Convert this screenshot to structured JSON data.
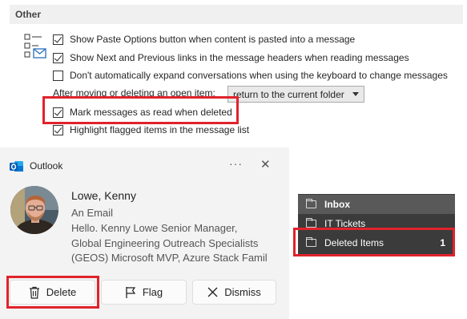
{
  "options": {
    "section_title": "Other",
    "icon": "mail-options-icon",
    "items": [
      {
        "label": "Show Paste Options button when content is pasted into a message",
        "checked": true
      },
      {
        "label": "Show Next and Previous links in the message headers when reading messages",
        "checked": true
      },
      {
        "label": "Don't automatically expand conversations when using the keyboard to change messages",
        "checked": false
      }
    ],
    "after_label": "After moving or deleting an open item:",
    "after_select_value": "return to the current folder",
    "items_after": [
      {
        "label": "Mark messages as read when deleted",
        "checked": true
      },
      {
        "label": "Highlight flagged items in the message list",
        "checked": true
      }
    ]
  },
  "toast": {
    "app_name": "Outlook",
    "more_glyph": "···",
    "close_glyph": "✕",
    "sender": "Lowe, Kenny",
    "subject": "An Email",
    "body_lines": [
      "Hello.  Kenny Lowe  Senior Manager,",
      "Global Engineering Outreach Specialists",
      "(GEOS)  Microsoft MVP, Azure Stack Famil"
    ],
    "buttons": {
      "delete": "Delete",
      "flag": "Flag",
      "dismiss": "Dismiss"
    }
  },
  "folders": [
    {
      "name": "Inbox",
      "count": "",
      "bold": true
    },
    {
      "name": "IT Tickets",
      "count": "",
      "bold": false
    },
    {
      "name": "Deleted Items",
      "count": "1",
      "bold": false
    }
  ],
  "colors": {
    "highlight_red": "#e0232b",
    "toast_bg": "#f3f3f3",
    "folder_pane_bg": "#3b3b3b",
    "inbox_selected_bg": "#595959",
    "outlook_blue": "#0a5fb4"
  }
}
